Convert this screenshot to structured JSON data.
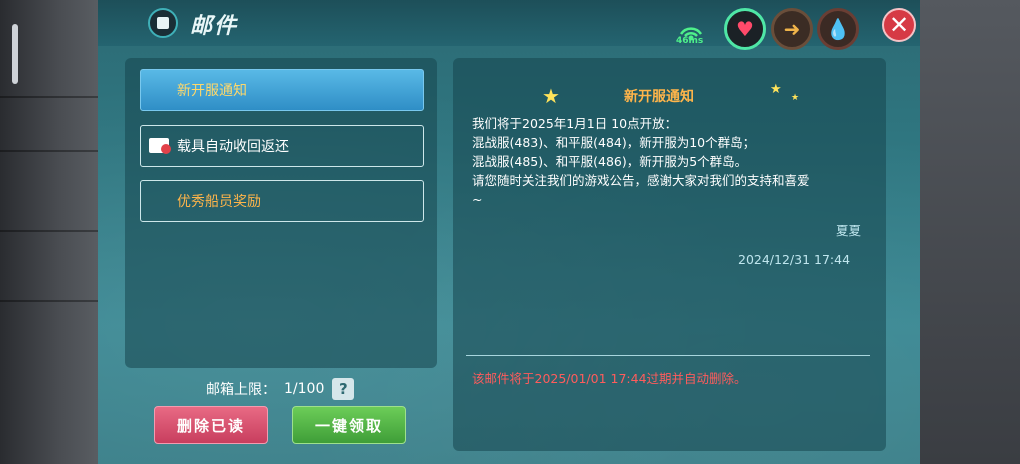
{
  "header": {
    "title": "邮件",
    "network": "46ms"
  },
  "mail_list": [
    {
      "label": "新开服通知",
      "selected": true
    },
    {
      "label": "载具自动收回返还",
      "selected": false
    },
    {
      "label": "优秀船员奖励",
      "selected": false
    }
  ],
  "mailbox": {
    "limit_label": "邮箱上限：",
    "limit_value": "1/100",
    "help": "?"
  },
  "buttons": {
    "delete_read": "删除已读",
    "claim_all": "一键领取"
  },
  "detail": {
    "title": "新开服通知",
    "body_lines": [
      "我们将于2025年1月1日 10点开放：",
      "混战服(483)、和平服(484)，新开服为10个群岛；",
      "混战服(485)、和平服(486)，新开服为5个群岛。",
      "请您随时关注我们的游戏公告，感谢大家对我们的支持和喜爱",
      "~"
    ],
    "sender": "夏夏",
    "date": "2024/12/31 17:44",
    "expire_notice": "该邮件将于2025/01/01 17:44过期并自动删除。"
  },
  "colors": {
    "panel": "#2f7680",
    "selected_item": "#3a9fd4",
    "title_orange": "#ffb54a",
    "expire_red": "#ff5c5c"
  }
}
